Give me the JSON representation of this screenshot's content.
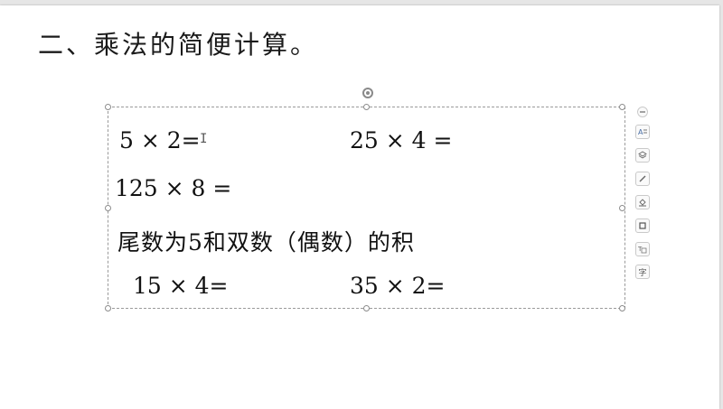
{
  "slide": {
    "title": "二、乘法的简便计算。"
  },
  "textbox": {
    "equations": [
      {
        "text": "5 × 2="
      },
      {
        "text": "25 × 4 ="
      },
      {
        "text": "125 × 8 ="
      },
      {
        "text": "15 × 4="
      },
      {
        "text": "35 × 2="
      }
    ],
    "note": "尾数为5和双数（偶数）的积",
    "cursor_glyph": "I"
  },
  "toolbar": {
    "text_style_glyph": "字"
  },
  "icons": {
    "collapse": "minus-icon",
    "style": "text-style-icon",
    "layers": "layers-icon",
    "pen": "pen-icon",
    "fill": "fill-bucket-icon",
    "outline": "outline-box-icon",
    "effect": "text-effect-icon",
    "font": "font-icon"
  }
}
